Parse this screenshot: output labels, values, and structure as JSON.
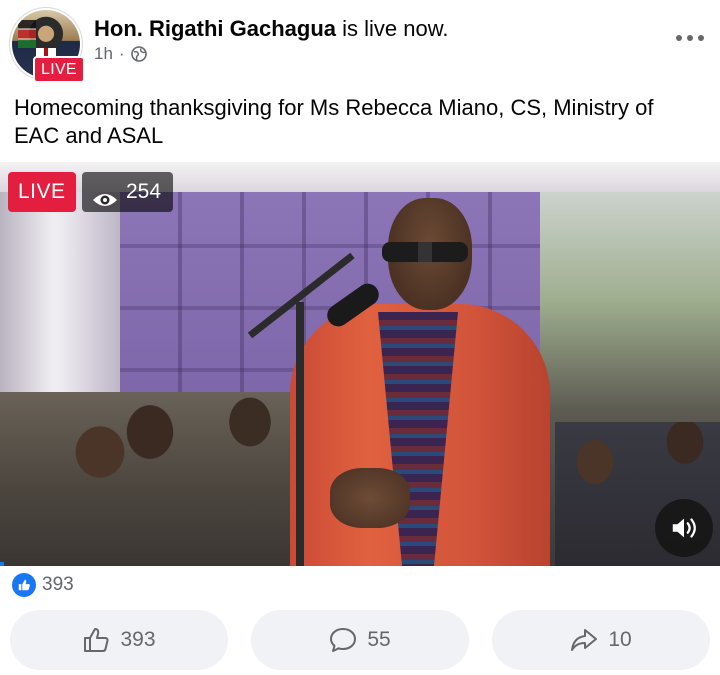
{
  "post": {
    "author": "Hon. Rigathi Gachagua",
    "status": "is live now.",
    "time": "1h",
    "privacy_icon": "globe-icon",
    "avatar_live_label": "LIVE",
    "caption": "Homecoming thanksgiving for Ms Rebecca Miano, CS, Ministry of EAC and ASAL"
  },
  "video": {
    "live_label": "LIVE",
    "viewers": "254",
    "sound_icon": "volume-icon"
  },
  "reactions": {
    "like_count": "393"
  },
  "actions": {
    "like_count": "393",
    "comment_count": "55",
    "share_count": "10"
  },
  "colors": {
    "live_red": "#e41e3f",
    "facebook_blue": "#1877f2",
    "muted_text": "#65676b",
    "button_bg": "#f0f2f5"
  }
}
